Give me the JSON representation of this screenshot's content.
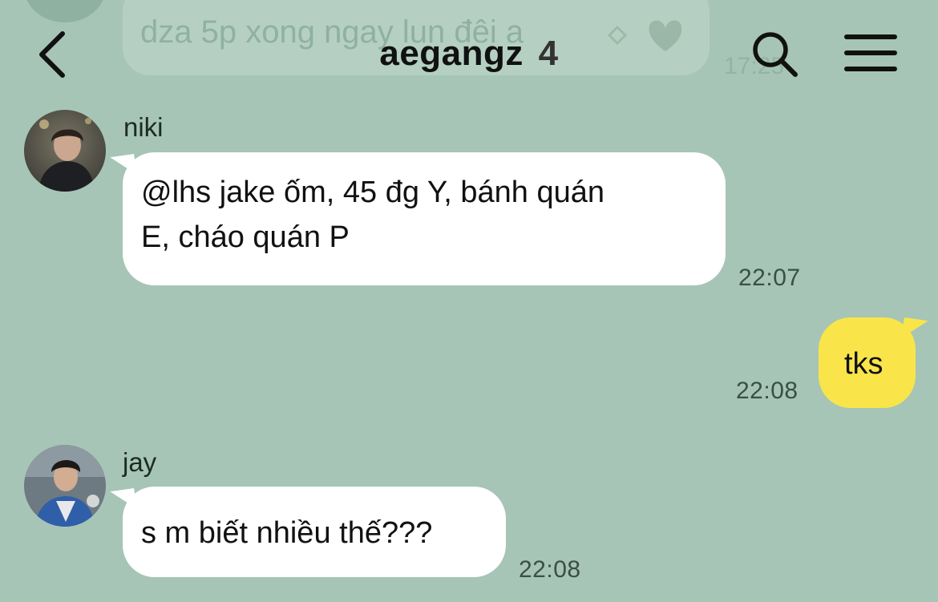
{
  "header": {
    "title": "aegangz",
    "member_count": "4"
  },
  "previous_message": {
    "text": "dza 5p xong ngay lun đêi a",
    "time": "17:25"
  },
  "messages": [
    {
      "sender": "niki",
      "direction": "incoming",
      "text_line1": "@lhs jake ốm, 45 đg Y, bánh quán",
      "text_line2": "E, cháo quán P",
      "time": "22:07"
    },
    {
      "sender": "",
      "direction": "outgoing",
      "text": "tks",
      "time": "22:08"
    },
    {
      "sender": "jay",
      "direction": "incoming",
      "text": "s m biết nhiều thế???",
      "time": "22:08"
    }
  ],
  "colors": {
    "background": "#a6c5b6",
    "incoming_bubble": "#ffffff",
    "outgoing_bubble": "#f9e54a"
  },
  "icons": {
    "back": "chevron-left-icon",
    "search": "search-icon",
    "menu": "hamburger-menu-icon"
  }
}
